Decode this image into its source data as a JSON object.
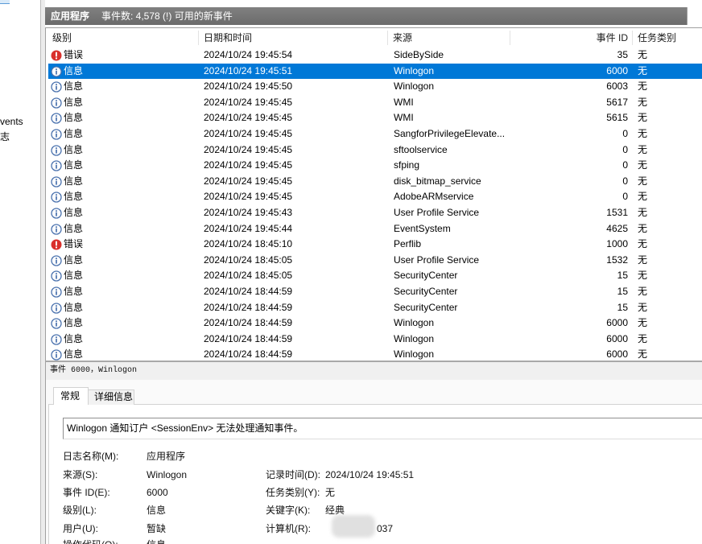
{
  "left_nav": {
    "items": [
      "vents",
      "志"
    ]
  },
  "header": {
    "title": "应用程序",
    "summary": "事件数: 4,578 (!) 可用的新事件"
  },
  "events_table": {
    "columns": {
      "level": "级别",
      "datetime": "日期和时间",
      "source": "来源",
      "event_id": "事件 ID",
      "task_category": "任务类别"
    },
    "rows": [
      {
        "icon": "error-icon",
        "level": "错误",
        "datetime": "2024/10/24 19:45:54",
        "source": "SideBySide",
        "event_id": "35",
        "task_category": "无"
      },
      {
        "icon": "info-icon",
        "level": "信息",
        "datetime": "2024/10/24 19:45:51",
        "source": "Winlogon",
        "event_id": "6000",
        "task_category": "无",
        "selected": true
      },
      {
        "icon": "info-icon",
        "level": "信息",
        "datetime": "2024/10/24 19:45:50",
        "source": "Winlogon",
        "event_id": "6003",
        "task_category": "无"
      },
      {
        "icon": "info-icon",
        "level": "信息",
        "datetime": "2024/10/24 19:45:45",
        "source": "WMI",
        "event_id": "5617",
        "task_category": "无"
      },
      {
        "icon": "info-icon",
        "level": "信息",
        "datetime": "2024/10/24 19:45:45",
        "source": "WMI",
        "event_id": "5615",
        "task_category": "无"
      },
      {
        "icon": "info-icon",
        "level": "信息",
        "datetime": "2024/10/24 19:45:45",
        "source": "SangforPrivilegeElevate...",
        "event_id": "0",
        "task_category": "无"
      },
      {
        "icon": "info-icon",
        "level": "信息",
        "datetime": "2024/10/24 19:45:45",
        "source": "sftoolservice",
        "event_id": "0",
        "task_category": "无"
      },
      {
        "icon": "info-icon",
        "level": "信息",
        "datetime": "2024/10/24 19:45:45",
        "source": "sfping",
        "event_id": "0",
        "task_category": "无"
      },
      {
        "icon": "info-icon",
        "level": "信息",
        "datetime": "2024/10/24 19:45:45",
        "source": "disk_bitmap_service",
        "event_id": "0",
        "task_category": "无"
      },
      {
        "icon": "info-icon",
        "level": "信息",
        "datetime": "2024/10/24 19:45:45",
        "source": "AdobeARMservice",
        "event_id": "0",
        "task_category": "无"
      },
      {
        "icon": "info-icon",
        "level": "信息",
        "datetime": "2024/10/24 19:45:43",
        "source": "User Profile Service",
        "event_id": "1531",
        "task_category": "无"
      },
      {
        "icon": "info-icon",
        "level": "信息",
        "datetime": "2024/10/24 19:45:44",
        "source": "EventSystem",
        "event_id": "4625",
        "task_category": "无"
      },
      {
        "icon": "error-icon",
        "level": "错误",
        "datetime": "2024/10/24 18:45:10",
        "source": "Perflib",
        "event_id": "1000",
        "task_category": "无"
      },
      {
        "icon": "info-icon",
        "level": "信息",
        "datetime": "2024/10/24 18:45:05",
        "source": "User Profile Service",
        "event_id": "1532",
        "task_category": "无"
      },
      {
        "icon": "info-icon",
        "level": "信息",
        "datetime": "2024/10/24 18:45:05",
        "source": "SecurityCenter",
        "event_id": "15",
        "task_category": "无"
      },
      {
        "icon": "info-icon",
        "level": "信息",
        "datetime": "2024/10/24 18:44:59",
        "source": "SecurityCenter",
        "event_id": "15",
        "task_category": "无"
      },
      {
        "icon": "info-icon",
        "level": "信息",
        "datetime": "2024/10/24 18:44:59",
        "source": "SecurityCenter",
        "event_id": "15",
        "task_category": "无"
      },
      {
        "icon": "info-icon",
        "level": "信息",
        "datetime": "2024/10/24 18:44:59",
        "source": "Winlogon",
        "event_id": "6000",
        "task_category": "无"
      },
      {
        "icon": "info-icon",
        "level": "信息",
        "datetime": "2024/10/24 18:44:59",
        "source": "Winlogon",
        "event_id": "6000",
        "task_category": "无"
      },
      {
        "icon": "info-icon",
        "level": "信息",
        "datetime": "2024/10/24 18:44:59",
        "source": "Winlogon",
        "event_id": "6000",
        "task_category": "无"
      }
    ]
  },
  "detail": {
    "caption": "事件 6000，Winlogon",
    "tabs": [
      {
        "label": "常规",
        "selected": true
      },
      {
        "label": "详细信息",
        "selected": false
      }
    ],
    "message": "Winlogon 通知订户 <SessionEnv> 无法处理通知事件。",
    "fields": {
      "log_name": {
        "label": "日志名称(M):",
        "value": "应用程序"
      },
      "source": {
        "label": "来源(S):",
        "value": "Winlogon"
      },
      "logged": {
        "label": "记录时间(D):",
        "value": "2024/10/24 19:45:51"
      },
      "event_id": {
        "label": "事件 ID(E):",
        "value": "6000"
      },
      "task_category": {
        "label": "任务类别(Y):",
        "value": "无"
      },
      "level": {
        "label": "级别(L):",
        "value": "信息"
      },
      "keywords": {
        "label": "关键字(K):",
        "value": "经典"
      },
      "user": {
        "label": "用户(U):",
        "value": "暂缺"
      },
      "computer": {
        "label": "计算机(R):",
        "value": "037"
      },
      "opcode": {
        "label": "操作代码(O):",
        "value": "信息"
      }
    }
  },
  "colors": {
    "selection": "#0078d7",
    "header_bar": "#727272",
    "error_icon": "#d9302c",
    "info_icon": "#4a72ae"
  }
}
